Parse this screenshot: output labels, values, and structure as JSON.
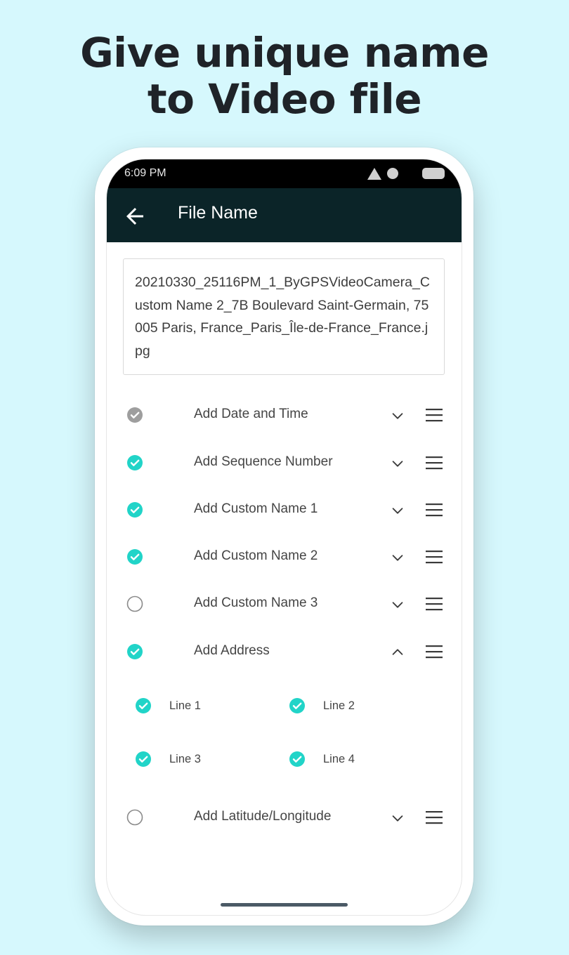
{
  "headline": {
    "line1": "Give unique name",
    "line2": "to Video file"
  },
  "status_bar": {
    "time": "6:09 PM"
  },
  "app_bar": {
    "title": "File Name"
  },
  "file_name_preview": "20210330_25116PM_1_ByGPSVideoCamera_Custom Name 2_7B Boulevard Saint-Germain, 75005 Paris, France_Paris_Île-de-France_France.jpg",
  "colors": {
    "accent": "#21d4c8",
    "disabled_check": "#9e9e9e",
    "appbar": "#0b2428",
    "background": "#d6f8fd"
  },
  "options": [
    {
      "label": "Add Date and Time",
      "state": "checked-disabled",
      "expanded": false
    },
    {
      "label": "Add Sequence Number",
      "state": "checked",
      "expanded": false
    },
    {
      "label": "Add Custom Name 1",
      "state": "checked",
      "expanded": false
    },
    {
      "label": "Add Custom Name 2",
      "state": "checked",
      "expanded": false
    },
    {
      "label": "Add Custom Name 3",
      "state": "unchecked",
      "expanded": false
    },
    {
      "label": "Add Address",
      "state": "checked",
      "expanded": true
    },
    {
      "label": "Add Latitude/Longitude",
      "state": "unchecked",
      "expanded": false
    }
  ],
  "address_lines": [
    {
      "label": "Line 1",
      "checked": true
    },
    {
      "label": "Line 2",
      "checked": true
    },
    {
      "label": "Line 3",
      "checked": true
    },
    {
      "label": "Line 4",
      "checked": true
    }
  ],
  "icons": {
    "back": "arrow-left-icon",
    "collapse": "chevron-down-icon",
    "expand": "chevron-up-icon",
    "reorder": "drag-handle-icon",
    "checked": "check-circle-icon",
    "unchecked": "empty-circle-icon"
  }
}
